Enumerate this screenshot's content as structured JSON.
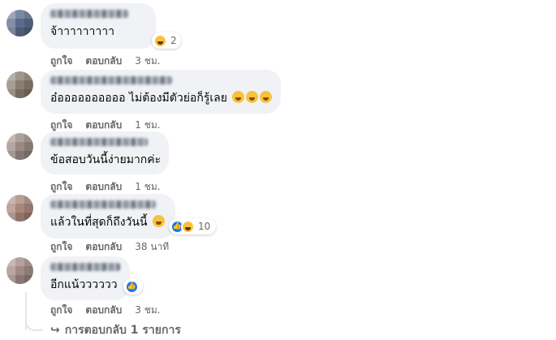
{
  "comments": [
    {
      "text": "จ้าาาาาาาาา",
      "reactions": {
        "icons": [
          "haha-icon"
        ],
        "count": "2"
      },
      "like_label": "ถูกใจ",
      "reply_label": "ตอบกลับ",
      "time": "3 ชม."
    },
    {
      "text": "อ๋ออออออออออ ไม่ต้องมีตัวย่อก็รู้เลย",
      "emojis": [
        "rofl-emoji",
        "rofl-emoji",
        "rofl-emoji"
      ],
      "like_label": "ถูกใจ",
      "reply_label": "ตอบกลับ",
      "time": "1 ชม."
    },
    {
      "text": "ข้อสอบวันนี้ง่ายมากค่ะ",
      "like_label": "ถูกใจ",
      "reply_label": "ตอบกลับ",
      "time": "1 ชม."
    },
    {
      "text": "แล้วในที่สุดก็ถึงวันนี้",
      "emojis": [
        "grin-emoji"
      ],
      "reactions": {
        "icons": [
          "like-icon",
          "haha-icon"
        ],
        "count": "10"
      },
      "like_label": "ถูกใจ",
      "reply_label": "ตอบกลับ",
      "time": "38 นาที"
    },
    {
      "text": "อีกแน้วววววว",
      "reactions": {
        "icons": [
          "like-icon"
        ],
        "count": ""
      },
      "like_label": "ถูกใจ",
      "reply_label": "ตอบกลับ",
      "time": "3 ชม."
    }
  ],
  "replies_link": "การตอบกลับ 1 รายการ",
  "colors": {
    "bubble": "#f0f2f5",
    "meta": "#65676b",
    "like_blue": "#1877f2",
    "emoji_yellow": "#f7c33c"
  }
}
